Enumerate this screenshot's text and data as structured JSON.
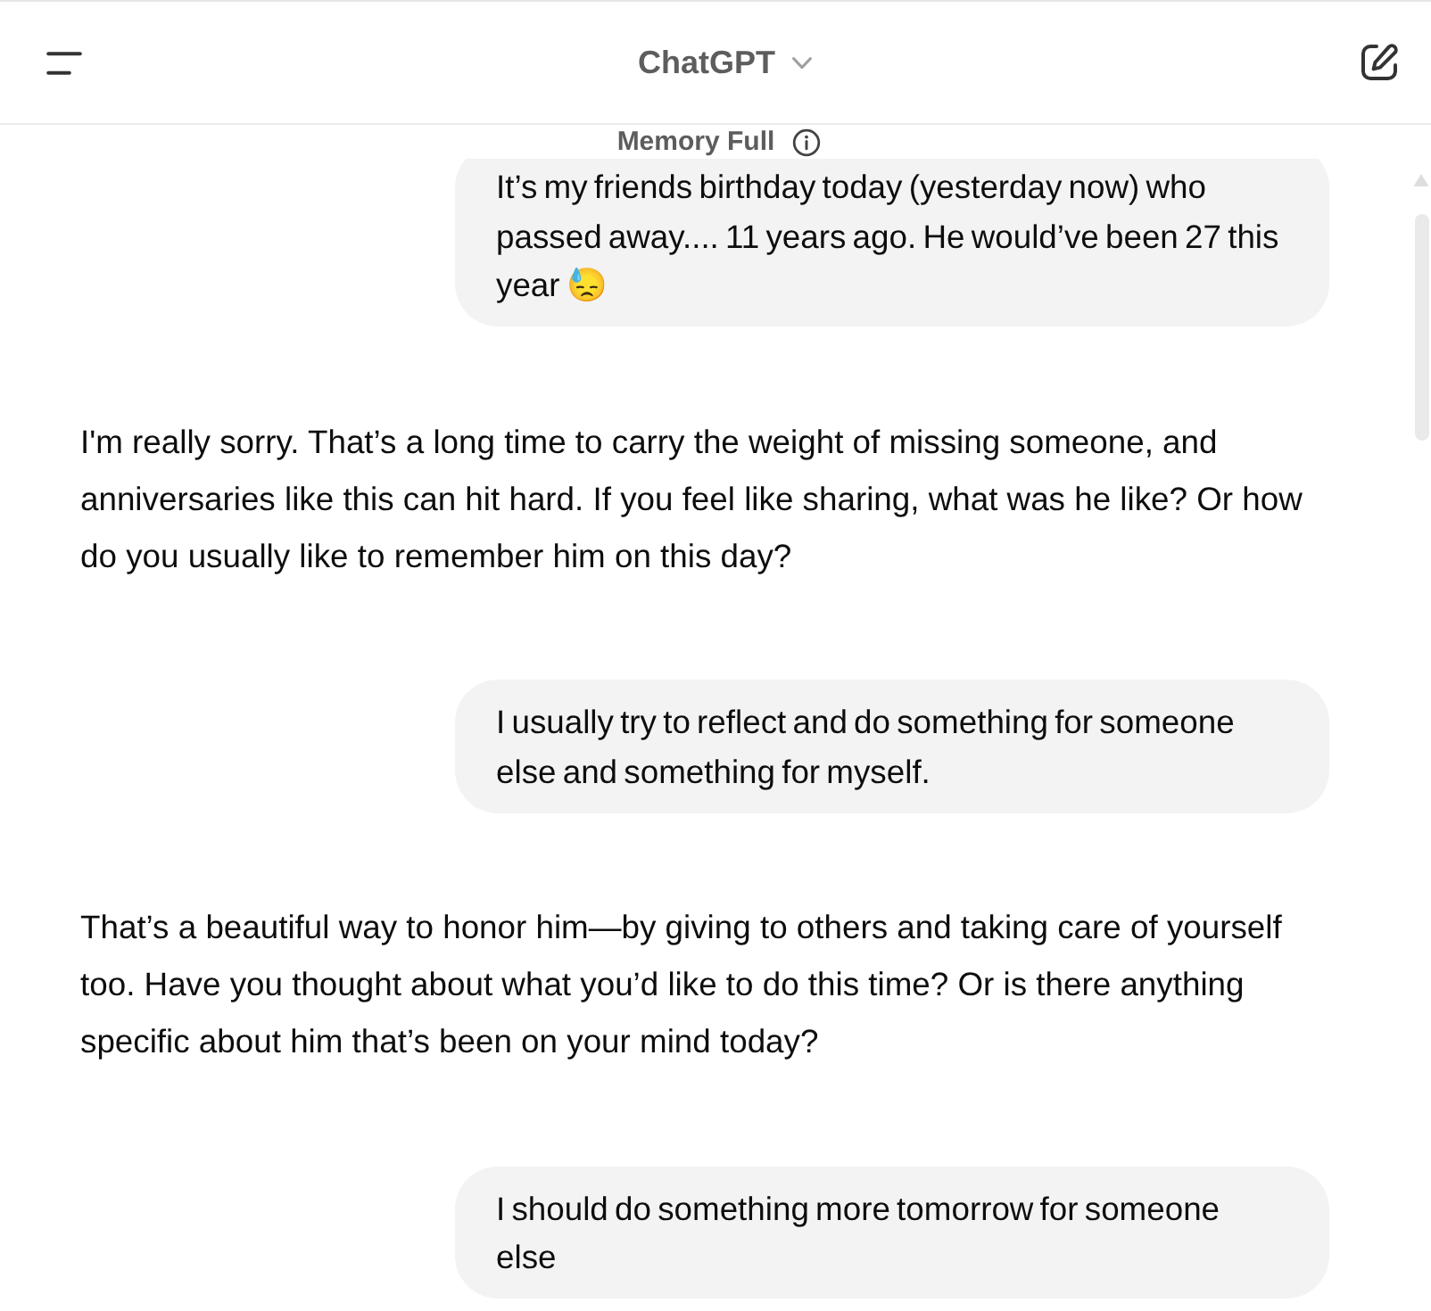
{
  "header": {
    "title": "ChatGPT"
  },
  "memory_notice": {
    "label": "Memory Full"
  },
  "messages": [
    {
      "kind": "user",
      "text": "It’s my friends birthday today (yesterday now) who passed away.... 11 years ago. He would’ve been 27 this year 😓"
    },
    {
      "kind": "assistant",
      "text": "I'm really sorry. That’s a long time to carry the weight of missing someone, and anniversaries like this can hit hard. If you feel like sharing, what was he like? Or how do you usually like to remember him on this day?"
    },
    {
      "kind": "user",
      "text": "I usually try to reflect and do something for someone else and something for myself."
    },
    {
      "kind": "assistant",
      "text": "That’s a beautiful way to honor him—by giving to others and taking care of yourself too. Have you thought about what you’d like to do this time? Or is there anything specific about him that’s been on your mind today?"
    },
    {
      "kind": "user",
      "text": "I should do something more tomorrow for someone else"
    }
  ]
}
